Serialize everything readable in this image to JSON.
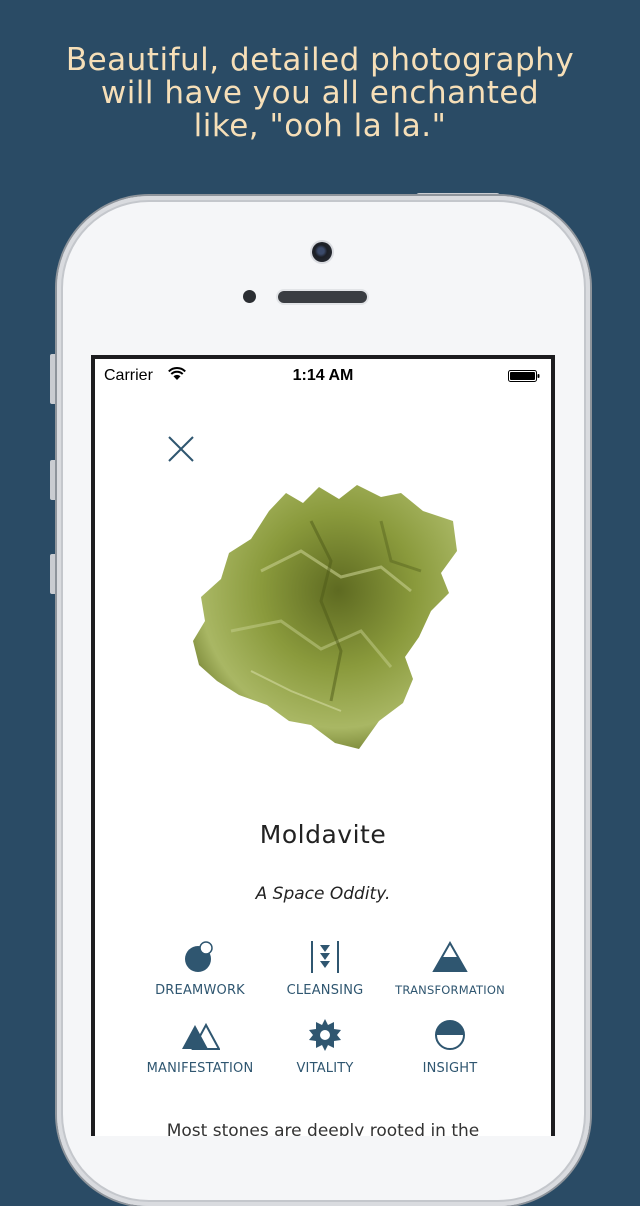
{
  "headline": {
    "line1": "Beautiful, detailed photography",
    "line2": "will have you all enchanted",
    "line3": "like, \"ooh la la.\""
  },
  "status_bar": {
    "carrier": "Carrier",
    "time": "1:14 AM"
  },
  "stone": {
    "name": "Moldavite",
    "tagline": "A Space Oddity.",
    "image_icon": "moldavite-photo",
    "description_start": "Most stones are deeply rooted in the"
  },
  "properties": [
    {
      "label": "DREAMWORK",
      "icon": "dreamwork-icon"
    },
    {
      "label": "CLEANSING",
      "icon": "cleansing-icon"
    },
    {
      "label": "TRANSFORMATION",
      "icon": "transformation-icon"
    },
    {
      "label": "MANIFESTATION",
      "icon": "manifestation-icon"
    },
    {
      "label": "VITALITY",
      "icon": "vitality-icon"
    },
    {
      "label": "INSIGHT",
      "icon": "insight-icon"
    }
  ],
  "colors": {
    "background": "#2a4b65",
    "headline": "#f6dfb8",
    "accent": "#2f5670",
    "stone": "#8a9a3c"
  }
}
